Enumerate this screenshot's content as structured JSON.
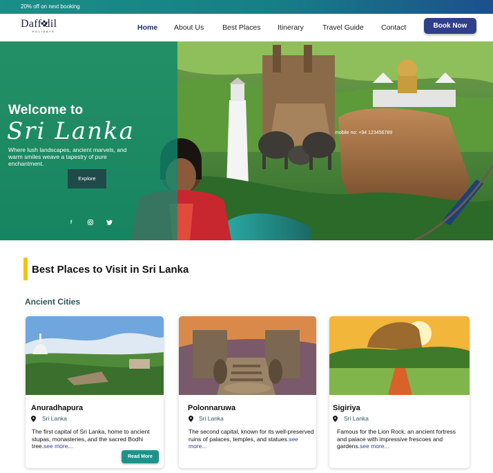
{
  "topbar": {
    "promo": "20% off on next booking"
  },
  "logo": {
    "word": "Daff dil",
    "sub": "HOLIDAYS"
  },
  "nav": {
    "items": [
      "Home",
      "About Us",
      "Best Places",
      "Itinerary",
      "Travel Guide",
      "Contact"
    ],
    "active": "Home",
    "book_label": "Book Now"
  },
  "hero": {
    "welcome": "Welcome to",
    "script": "Sri Lanka",
    "description": "Where lush landscapes, ancient marvels, and warm smiles weave a tapestry of pure enchantment.",
    "explore_label": "Explore",
    "mobile": "mobile no: +94 123456789",
    "social_icons": [
      "facebook-icon",
      "instagram-icon",
      "twitter-icon"
    ]
  },
  "section": {
    "title": "Best Places to Visit in Sri Lanka",
    "category": "Ancient Cities"
  },
  "cards": [
    {
      "title": "Anuradhapura",
      "location": "Sri Lanka",
      "description": "The first capital of Sri Lanka, home to ancient stupas, monasteries, and the sacred Bodhi tree.",
      "see_more": "see more...",
      "read_more": "Read More"
    },
    {
      "title": "Polonnaruwa",
      "location": "Sri Lanka",
      "description": " The second capital, known for its well-preserved ruins of palaces, temples, and statues.",
      "see_more": "see more..."
    },
    {
      "title": "Sigiriya",
      "location": "Sri Lanka",
      "description": "Famous for the Lion Rock, an ancient fortress and palace with impressive frescoes and gardens.",
      "see_more": "see more..."
    }
  ],
  "colors": {
    "brand_teal": "#20918a",
    "brand_navy": "#2f3f8a",
    "accent_yellow": "#f4c400"
  }
}
